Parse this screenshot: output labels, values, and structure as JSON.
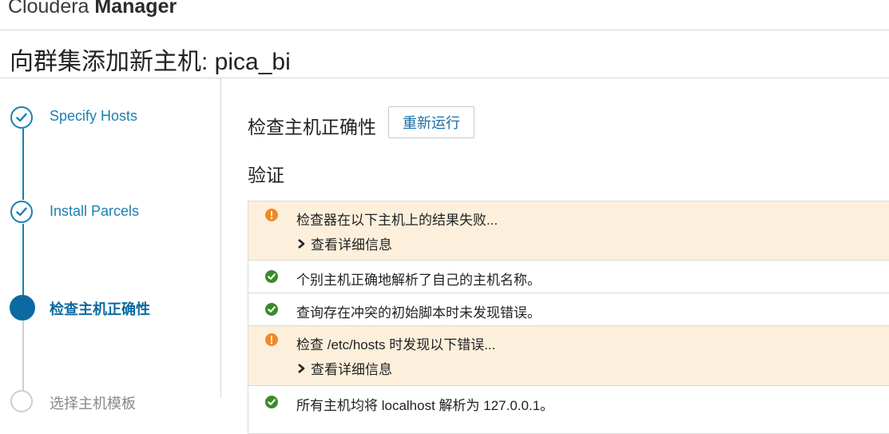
{
  "app": {
    "brand_light": "Cloudera ",
    "brand_bold": "Manager"
  },
  "page": {
    "title": "向群集添加新主机: pica_bi"
  },
  "steps": [
    {
      "label": "Specify Hosts",
      "state": "done"
    },
    {
      "label": "Install Parcels",
      "state": "done"
    },
    {
      "label": "检查主机正确性",
      "state": "active"
    },
    {
      "label": "选择主机模板",
      "state": "todo"
    }
  ],
  "main": {
    "section_title": "检查主机正确性",
    "rerun_label": "重新运行",
    "verify_title": "验证",
    "results": [
      {
        "status": "warning",
        "message": "检查器在以下主机上的结果失败...",
        "details_label": "查看详细信息"
      },
      {
        "status": "ok",
        "message": "个别主机正确地解析了自己的主机名称。"
      },
      {
        "status": "ok",
        "message": "查询存在冲突的初始脚本时未发现错误。"
      },
      {
        "status": "warning",
        "message": "检查 /etc/hosts 时发现以下错误...",
        "details_label": "查看详细信息"
      },
      {
        "status": "ok",
        "message": "所有主机均将 localhost 解析为 127.0.0.1。"
      }
    ]
  },
  "colors": {
    "accent": "#1b7fb1",
    "active_step": "#0a6aa1",
    "warning_bg": "#fcf0dc",
    "warning_icon": "#f08a24",
    "ok_icon": "#3c8a28"
  }
}
